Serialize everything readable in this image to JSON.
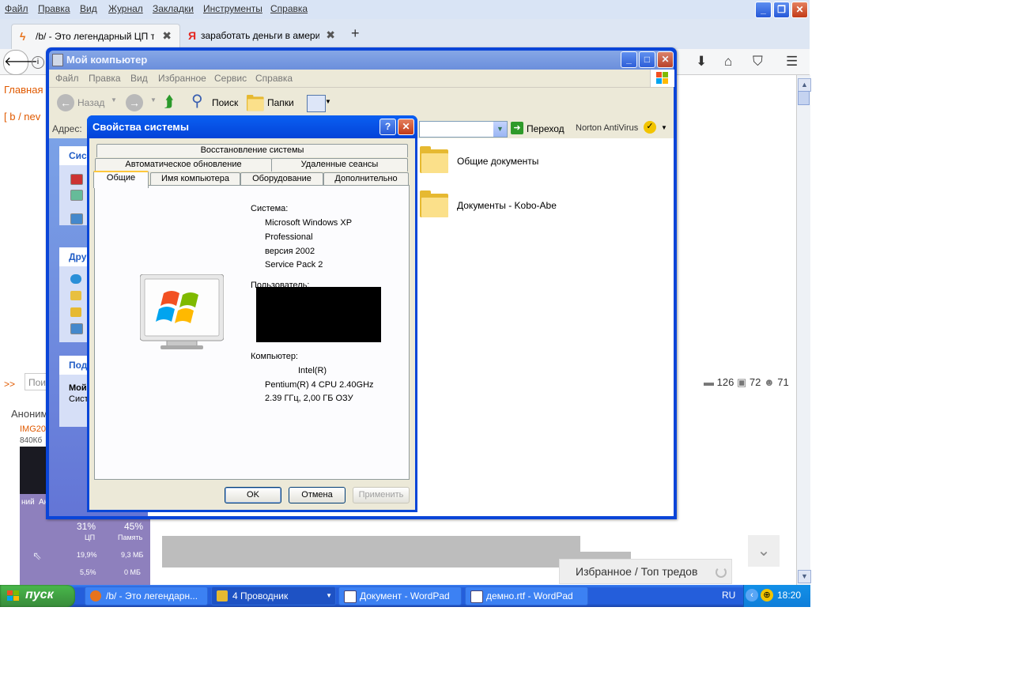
{
  "firefox": {
    "menu": [
      "Файл",
      "Правка",
      "Вид",
      "Журнал",
      "Закладки",
      "Инструменты",
      "Справка"
    ],
    "tabs": [
      {
        "title": "/b/ - Это легендарный ЦП т...",
        "icon": "lightning-icon"
      },
      {
        "title": "заработать деньги в амери...",
        "icon": "yandex-icon"
      }
    ],
    "new_tab": "+",
    "tab_close": "✖",
    "page": {
      "nav_main": "Главная",
      "board_path": "[ b / nev",
      "arrows": ">>",
      "search_placeholder": "Пои",
      "stats": {
        "posts": "126",
        "images": "72",
        "users": "71"
      },
      "anon": "Аноним",
      "img_link": "IMG20",
      "img_size": "840Кб",
      "thumb": {
        "cpu": "31%",
        "mem": "45%",
        "cpu_label": "ЦП",
        "mem_label": "Память",
        "row1_cpu": "19,9%",
        "row1_mem": "9,3 МБ",
        "row2_cpu": "5,5%",
        "row2_mem": "0 МБ",
        "col1": "ний",
        "col2": "Ак"
      },
      "favorites": "Избранное / Топ тредов"
    }
  },
  "my_computer": {
    "title": "Мой компьютер",
    "menu": [
      "Файл",
      "Правка",
      "Вид",
      "Избранное",
      "Сервис",
      "Справка"
    ],
    "toolbar": {
      "back": "Назад",
      "search": "Поиск",
      "folders": "Папки"
    },
    "address_label": "Адрес:",
    "go": "Переход",
    "norton": "Norton AntiVirus",
    "left_heads": [
      "Сист",
      "Дру",
      "Под"
    ],
    "details_title": "Мой",
    "details_sub": "Сист",
    "folders": [
      "Общие документы",
      "Документы - Kobo-Abe"
    ]
  },
  "system_properties": {
    "title": "Свойства системы",
    "help": "?",
    "tabs_row1": [
      "Восстановление системы"
    ],
    "tabs_row2": [
      "Автоматическое обновление",
      "Удаленные сеансы"
    ],
    "tabs_row3": [
      "Общие",
      "Имя компьютера",
      "Оборудование",
      "Дополнительно"
    ],
    "system_label": "Система:",
    "system_lines": [
      "Microsoft Windows XP",
      "Professional",
      "версия 2002",
      "Service Pack 2"
    ],
    "user_label": "Пользователь:",
    "computer_label": "Компьютер:",
    "computer_lines": [
      "Intel(R)",
      "Pentium(R) 4 CPU 2.40GHz",
      "2.39 ГГц, 2,00 ГБ ОЗУ"
    ],
    "buttons": {
      "ok": "OK",
      "cancel": "Отмена",
      "apply": "Применить"
    }
  },
  "taskbar": {
    "start": "пуск",
    "tasks": [
      {
        "label": "/b/ - Это легендарн...",
        "icon": "firefox-icon"
      },
      {
        "label": "4 Проводник",
        "icon": "folder-icon"
      },
      {
        "label": "Документ - WordPad",
        "icon": "wordpad-icon"
      },
      {
        "label": "демно.rtf - WordPad",
        "icon": "wordpad-icon"
      }
    ],
    "lang": "RU",
    "clock": "18:20"
  },
  "colors": {
    "xp_blue": "#0846d8",
    "accent_orange": "#e05a00",
    "start_green": "#3c9a3e"
  }
}
